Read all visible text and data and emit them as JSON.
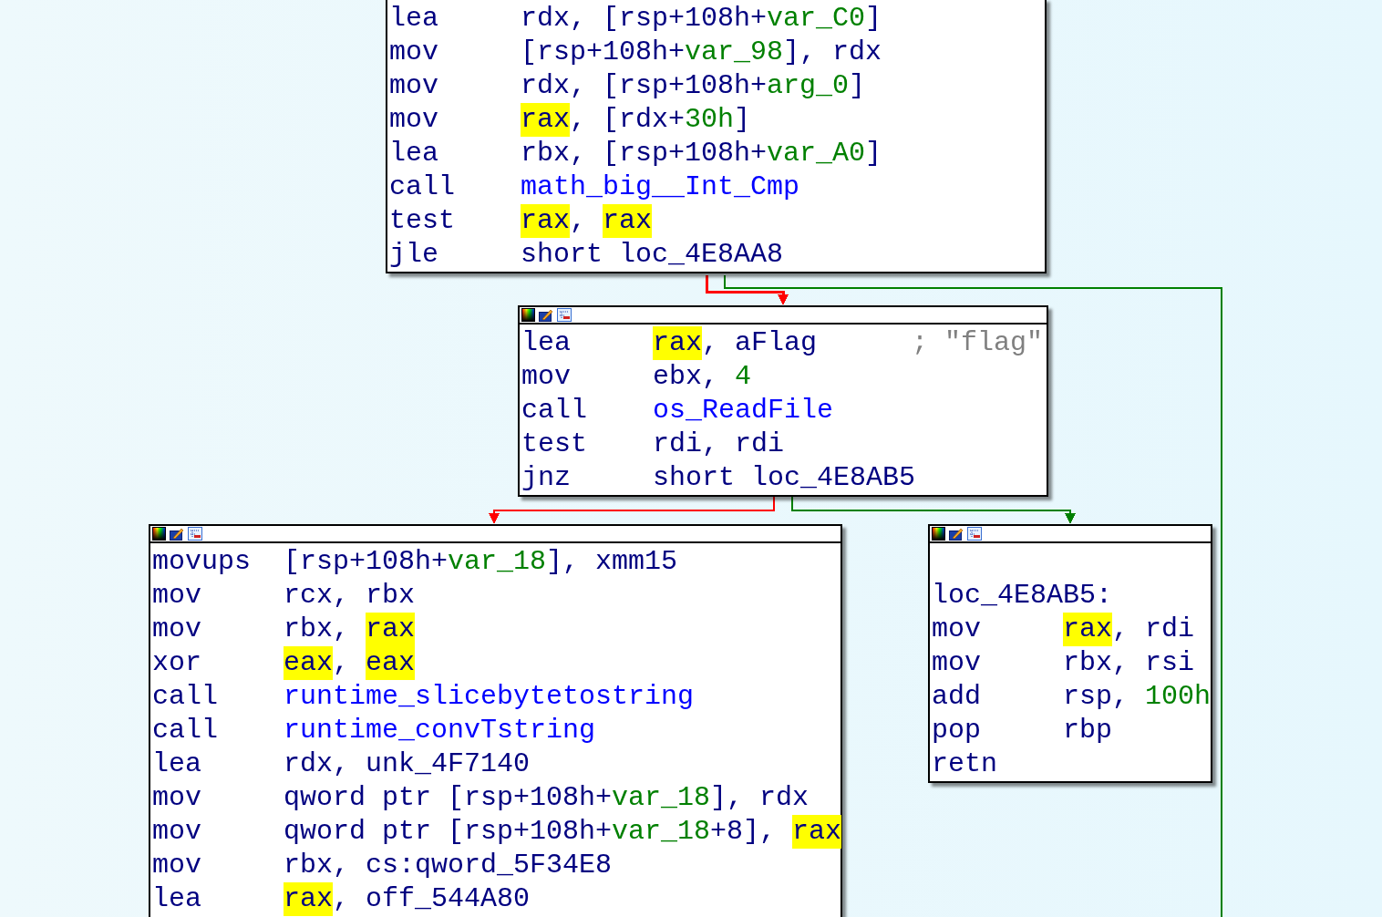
{
  "blocks": [
    {
      "toolbar": false,
      "lines": [
        {
          "kind": "ins",
          "mnemonic": "lea",
          "operands": [
            {
              "text": "rdx",
              "kind": "reg",
              "highlighted": false
            },
            {
              "text": ", [rsp+108h+",
              "kind": "plain",
              "highlighted": false
            },
            {
              "text": "var_C0",
              "kind": "var",
              "highlighted": false
            },
            {
              "text": "]",
              "kind": "plain",
              "highlighted": false
            }
          ]
        },
        {
          "kind": "ins",
          "mnemonic": "mov",
          "operands": [
            {
              "text": "[rsp+108h+",
              "kind": "plain",
              "highlighted": false
            },
            {
              "text": "var_98",
              "kind": "var",
              "highlighted": false
            },
            {
              "text": "], rdx",
              "kind": "plain",
              "highlighted": false
            }
          ]
        },
        {
          "kind": "ins",
          "mnemonic": "mov",
          "operands": [
            {
              "text": "rdx, [rsp+108h+",
              "kind": "plain",
              "highlighted": false
            },
            {
              "text": "arg_0",
              "kind": "var",
              "highlighted": false
            },
            {
              "text": "]",
              "kind": "plain",
              "highlighted": false
            }
          ]
        },
        {
          "kind": "ins",
          "mnemonic": "mov",
          "operands": [
            {
              "text": "rax",
              "kind": "reg",
              "highlighted": true
            },
            {
              "text": ", [rdx+",
              "kind": "plain",
              "highlighted": false
            },
            {
              "text": "30h",
              "kind": "var",
              "highlighted": false
            },
            {
              "text": "]",
              "kind": "plain",
              "highlighted": false
            }
          ]
        },
        {
          "kind": "ins",
          "mnemonic": "lea",
          "operands": [
            {
              "text": "rbx, [rsp+108h+",
              "kind": "plain",
              "highlighted": false
            },
            {
              "text": "var_A0",
              "kind": "var",
              "highlighted": false
            },
            {
              "text": "]",
              "kind": "plain",
              "highlighted": false
            }
          ]
        },
        {
          "kind": "ins",
          "mnemonic": "call",
          "operands": [
            {
              "text": "math_big__Int_Cmp",
              "kind": "name",
              "highlighted": false
            }
          ]
        },
        {
          "kind": "ins",
          "mnemonic": "test",
          "operands": [
            {
              "text": "rax",
              "kind": "reg",
              "highlighted": true
            },
            {
              "text": ", ",
              "kind": "plain",
              "highlighted": false
            },
            {
              "text": "rax",
              "kind": "reg",
              "highlighted": true
            }
          ]
        },
        {
          "kind": "ins",
          "mnemonic": "jle",
          "operands": [
            {
              "text": "short loc_4E8AA8",
              "kind": "plain",
              "highlighted": false
            }
          ]
        }
      ]
    },
    {
      "toolbar": true,
      "lines": [
        {
          "kind": "ins",
          "mnemonic": "lea",
          "operands": [
            {
              "text": "rax",
              "kind": "reg",
              "highlighted": true
            },
            {
              "text": ", aFlag",
              "kind": "plain",
              "highlighted": false
            }
          ],
          "comment": "; \"flag\""
        },
        {
          "kind": "ins",
          "mnemonic": "mov",
          "operands": [
            {
              "text": "ebx, ",
              "kind": "plain",
              "highlighted": false
            },
            {
              "text": "4",
              "kind": "var",
              "highlighted": false
            }
          ]
        },
        {
          "kind": "ins",
          "mnemonic": "call",
          "operands": [
            {
              "text": "os_ReadFile",
              "kind": "name",
              "highlighted": false
            }
          ]
        },
        {
          "kind": "ins",
          "mnemonic": "test",
          "operands": [
            {
              "text": "rdi, rdi",
              "kind": "plain",
              "highlighted": false
            }
          ]
        },
        {
          "kind": "ins",
          "mnemonic": "jnz",
          "operands": [
            {
              "text": "short loc_4E8AB5",
              "kind": "plain",
              "highlighted": false
            }
          ]
        }
      ]
    },
    {
      "toolbar": true,
      "lines": [
        {
          "kind": "ins",
          "mnemonic": "movups",
          "operands": [
            {
              "text": "[rsp+108h+",
              "kind": "plain",
              "highlighted": false
            },
            {
              "text": "var_18",
              "kind": "var",
              "highlighted": false
            },
            {
              "text": "], xmm15",
              "kind": "plain",
              "highlighted": false
            }
          ]
        },
        {
          "kind": "ins",
          "mnemonic": "mov",
          "operands": [
            {
              "text": "rcx, rbx",
              "kind": "plain",
              "highlighted": false
            }
          ]
        },
        {
          "kind": "ins",
          "mnemonic": "mov",
          "operands": [
            {
              "text": "rbx, ",
              "kind": "plain",
              "highlighted": false
            },
            {
              "text": "rax",
              "kind": "reg",
              "highlighted": true
            }
          ]
        },
        {
          "kind": "ins",
          "mnemonic": "xor",
          "operands": [
            {
              "text": "eax",
              "kind": "reg",
              "highlighted": true
            },
            {
              "text": ", ",
              "kind": "plain",
              "highlighted": false
            },
            {
              "text": "eax",
              "kind": "reg",
              "highlighted": true
            }
          ]
        },
        {
          "kind": "ins",
          "mnemonic": "call",
          "operands": [
            {
              "text": "runtime_slicebytetostring",
              "kind": "name",
              "highlighted": false
            }
          ]
        },
        {
          "kind": "ins",
          "mnemonic": "call",
          "operands": [
            {
              "text": "runtime_convTstring",
              "kind": "name",
              "highlighted": false
            }
          ]
        },
        {
          "kind": "ins",
          "mnemonic": "lea",
          "operands": [
            {
              "text": "rdx, unk_4F7140",
              "kind": "plain",
              "highlighted": false
            }
          ]
        },
        {
          "kind": "ins",
          "mnemonic": "mov",
          "operands": [
            {
              "text": "qword ptr [rsp+108h+",
              "kind": "plain",
              "highlighted": false
            },
            {
              "text": "var_18",
              "kind": "var",
              "highlighted": false
            },
            {
              "text": "], rdx",
              "kind": "plain",
              "highlighted": false
            }
          ]
        },
        {
          "kind": "ins",
          "mnemonic": "mov",
          "operands": [
            {
              "text": "qword ptr [rsp+108h+",
              "kind": "plain",
              "highlighted": false
            },
            {
              "text": "var_18",
              "kind": "var",
              "highlighted": false
            },
            {
              "text": "+8], ",
              "kind": "plain",
              "highlighted": false
            },
            {
              "text": "rax",
              "kind": "reg",
              "highlighted": true
            }
          ]
        },
        {
          "kind": "ins",
          "mnemonic": "mov",
          "operands": [
            {
              "text": "rbx, cs:qword_5F34E8",
              "kind": "plain",
              "highlighted": false
            }
          ]
        },
        {
          "kind": "ins",
          "mnemonic": "lea",
          "operands": [
            {
              "text": "rax",
              "kind": "reg",
              "highlighted": true
            },
            {
              "text": ", off_544A80",
              "kind": "plain",
              "highlighted": false
            }
          ]
        }
      ]
    },
    {
      "toolbar": true,
      "lines": [
        {
          "kind": "blank"
        },
        {
          "kind": "label",
          "text": "loc_4E8AB5:"
        },
        {
          "kind": "ins",
          "mnemonic": "mov",
          "operands": [
            {
              "text": "rax",
              "kind": "reg",
              "highlighted": true
            },
            {
              "text": ", rdi",
              "kind": "plain",
              "highlighted": false
            }
          ]
        },
        {
          "kind": "ins",
          "mnemonic": "mov",
          "operands": [
            {
              "text": "rbx, rsi",
              "kind": "plain",
              "highlighted": false
            }
          ]
        },
        {
          "kind": "ins",
          "mnemonic": "add",
          "operands": [
            {
              "text": "rsp, ",
              "kind": "plain",
              "highlighted": false
            },
            {
              "text": "100h",
              "kind": "var",
              "highlighted": false
            }
          ]
        },
        {
          "kind": "ins",
          "mnemonic": "pop",
          "operands": [
            {
              "text": "rbp",
              "kind": "plain",
              "highlighted": false
            }
          ]
        },
        {
          "kind": "ins",
          "mnemonic": "retn"
        }
      ]
    }
  ],
  "edges": [
    {
      "kind": "fallthrough"
    },
    {
      "kind": "taken"
    },
    {
      "kind": "fallthrough"
    },
    {
      "kind": "taken"
    }
  ]
}
